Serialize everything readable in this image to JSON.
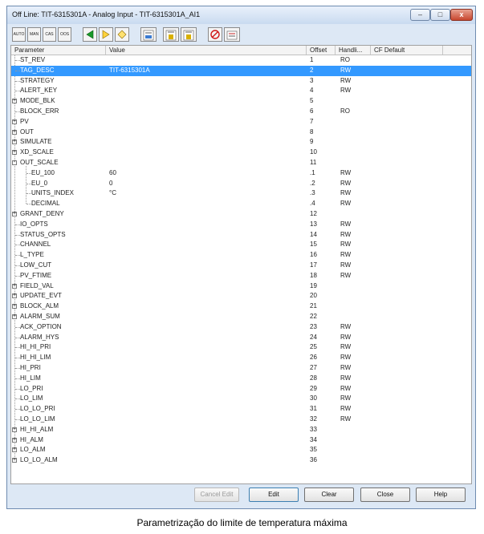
{
  "window": {
    "title": "Off Line: TIT-6315301A - Analog Input - TIT-6315301A_AI1",
    "minimize_glyph": "–",
    "maximize_glyph": "□",
    "close_glyph": "x"
  },
  "toolbar": {
    "auto_label": "AUTO",
    "man_label": "MAN",
    "cas_label": "CAS",
    "oos_label": "OOS",
    "icons": [
      "arrow-left-icon",
      "arrow-right-icon",
      "diamond-icon",
      "end-read-icon",
      "all-read-icon",
      "def-read-icon",
      "stop-icon",
      "download-icon"
    ]
  },
  "table": {
    "headers": {
      "parameter": "Parameter",
      "value": "Value",
      "offset": "Offset",
      "handling": "Handli...",
      "cf_default": "CF Default"
    },
    "rows": [
      {
        "name": "ST_REV",
        "value": "",
        "offset": "1",
        "handling": "RO",
        "level": 0,
        "expand": ""
      },
      {
        "name": "TAG_DESC",
        "value": "TIT-6315301A",
        "offset": "2",
        "handling": "RW",
        "level": 0,
        "expand": "",
        "selected": true
      },
      {
        "name": "STRATEGY",
        "value": "",
        "offset": "3",
        "handling": "RW",
        "level": 0,
        "expand": ""
      },
      {
        "name": "ALERT_KEY",
        "value": "",
        "offset": "4",
        "handling": "RW",
        "level": 0,
        "expand": ""
      },
      {
        "name": "MODE_BLK",
        "value": "",
        "offset": "5",
        "handling": "",
        "level": 0,
        "expand": "+"
      },
      {
        "name": "BLOCK_ERR",
        "value": "",
        "offset": "6",
        "handling": "RO",
        "level": 0,
        "expand": ""
      },
      {
        "name": "PV",
        "value": "",
        "offset": "7",
        "handling": "",
        "level": 0,
        "expand": "+"
      },
      {
        "name": "OUT",
        "value": "",
        "offset": "8",
        "handling": "",
        "level": 0,
        "expand": "+"
      },
      {
        "name": "SIMULATE",
        "value": "",
        "offset": "9",
        "handling": "",
        "level": 0,
        "expand": "+"
      },
      {
        "name": "XD_SCALE",
        "value": "",
        "offset": "10",
        "handling": "",
        "level": 0,
        "expand": "+"
      },
      {
        "name": "OUT_SCALE",
        "value": "",
        "offset": "11",
        "handling": "",
        "level": 0,
        "expand": "-"
      },
      {
        "name": "EU_100",
        "value": "60",
        "offset": ".1",
        "handling": "RW",
        "level": 1,
        "expand": ""
      },
      {
        "name": "EU_0",
        "value": "0",
        "offset": ".2",
        "handling": "RW",
        "level": 1,
        "expand": ""
      },
      {
        "name": "UNITS_INDEX",
        "value": "°C",
        "offset": ".3",
        "handling": "RW",
        "level": 1,
        "expand": ""
      },
      {
        "name": "DECIMAL",
        "value": "",
        "offset": ".4",
        "handling": "RW",
        "level": 1,
        "expand": ""
      },
      {
        "name": "GRANT_DENY",
        "value": "",
        "offset": "12",
        "handling": "",
        "level": 0,
        "expand": "+"
      },
      {
        "name": "IO_OPTS",
        "value": "",
        "offset": "13",
        "handling": "RW",
        "level": 0,
        "expand": ""
      },
      {
        "name": "STATUS_OPTS",
        "value": "",
        "offset": "14",
        "handling": "RW",
        "level": 0,
        "expand": ""
      },
      {
        "name": "CHANNEL",
        "value": "",
        "offset": "15",
        "handling": "RW",
        "level": 0,
        "expand": ""
      },
      {
        "name": "L_TYPE",
        "value": "",
        "offset": "16",
        "handling": "RW",
        "level": 0,
        "expand": ""
      },
      {
        "name": "LOW_CUT",
        "value": "",
        "offset": "17",
        "handling": "RW",
        "level": 0,
        "expand": ""
      },
      {
        "name": "PV_FTIME",
        "value": "",
        "offset": "18",
        "handling": "RW",
        "level": 0,
        "expand": ""
      },
      {
        "name": "FIELD_VAL",
        "value": "",
        "offset": "19",
        "handling": "",
        "level": 0,
        "expand": "+"
      },
      {
        "name": "UPDATE_EVT",
        "value": "",
        "offset": "20",
        "handling": "",
        "level": 0,
        "expand": "+"
      },
      {
        "name": "BLOCK_ALM",
        "value": "",
        "offset": "21",
        "handling": "",
        "level": 0,
        "expand": "+"
      },
      {
        "name": "ALARM_SUM",
        "value": "",
        "offset": "22",
        "handling": "",
        "level": 0,
        "expand": "+"
      },
      {
        "name": "ACK_OPTION",
        "value": "",
        "offset": "23",
        "handling": "RW",
        "level": 0,
        "expand": ""
      },
      {
        "name": "ALARM_HYS",
        "value": "",
        "offset": "24",
        "handling": "RW",
        "level": 0,
        "expand": ""
      },
      {
        "name": "HI_HI_PRI",
        "value": "",
        "offset": "25",
        "handling": "RW",
        "level": 0,
        "expand": ""
      },
      {
        "name": "HI_HI_LIM",
        "value": "",
        "offset": "26",
        "handling": "RW",
        "level": 0,
        "expand": ""
      },
      {
        "name": "HI_PRI",
        "value": "",
        "offset": "27",
        "handling": "RW",
        "level": 0,
        "expand": ""
      },
      {
        "name": "HI_LIM",
        "value": "",
        "offset": "28",
        "handling": "RW",
        "level": 0,
        "expand": ""
      },
      {
        "name": "LO_PRI",
        "value": "",
        "offset": "29",
        "handling": "RW",
        "level": 0,
        "expand": ""
      },
      {
        "name": "LO_LIM",
        "value": "",
        "offset": "30",
        "handling": "RW",
        "level": 0,
        "expand": ""
      },
      {
        "name": "LO_LO_PRI",
        "value": "",
        "offset": "31",
        "handling": "RW",
        "level": 0,
        "expand": ""
      },
      {
        "name": "LO_LO_LIM",
        "value": "",
        "offset": "32",
        "handling": "RW",
        "level": 0,
        "expand": ""
      },
      {
        "name": "HI_HI_ALM",
        "value": "",
        "offset": "33",
        "handling": "",
        "level": 0,
        "expand": "+"
      },
      {
        "name": "HI_ALM",
        "value": "",
        "offset": "34",
        "handling": "",
        "level": 0,
        "expand": "+"
      },
      {
        "name": "LO_ALM",
        "value": "",
        "offset": "35",
        "handling": "",
        "level": 0,
        "expand": "+"
      },
      {
        "name": "LO_LO_ALM",
        "value": "",
        "offset": "36",
        "handling": "",
        "level": 0,
        "expand": "+"
      }
    ]
  },
  "buttons": {
    "cancel_edit": "Cancel Edit",
    "edit": "Edit",
    "clear": "Clear",
    "close": "Close",
    "help": "Help"
  },
  "caption": "Parametrização do limite de temperatura máxima",
  "colors": {
    "selection": "#3399ff",
    "window_frame": "#dde8f5",
    "close_button": "#c7462f"
  }
}
